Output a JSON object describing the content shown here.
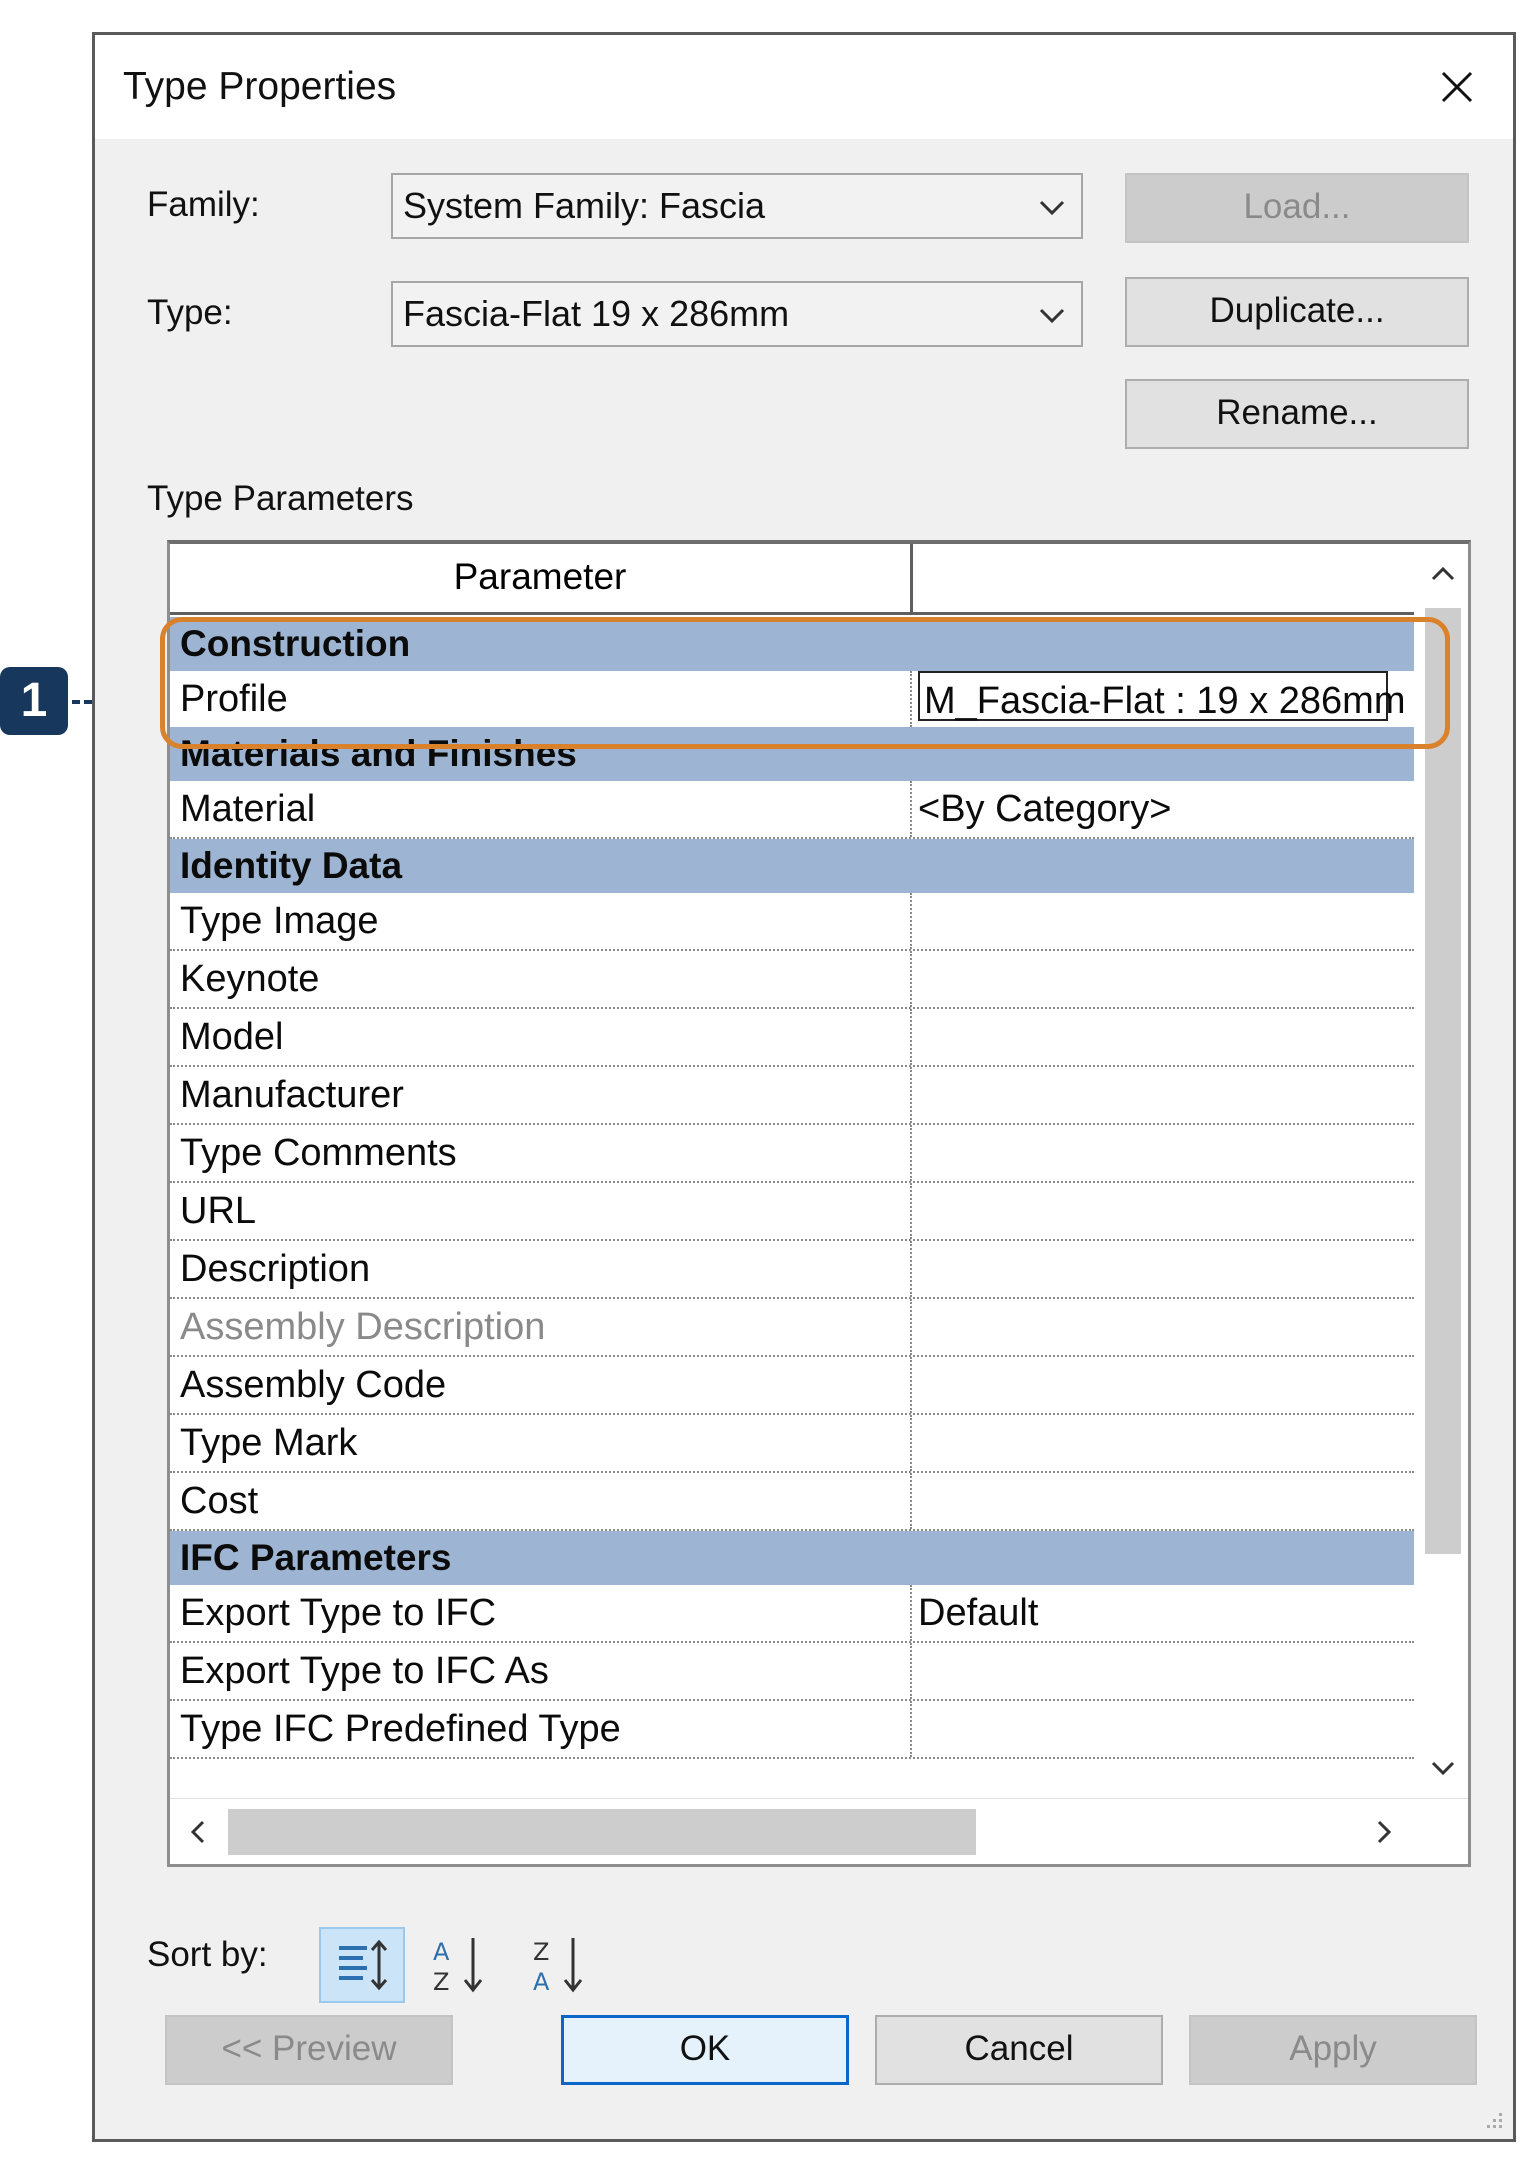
{
  "dialog": {
    "title": "Type Properties",
    "family_label": "Family:",
    "family_value": "System Family: Fascia",
    "type_label": "Type:",
    "type_value": "Fascia-Flat 19 x 286mm",
    "load_label": "Load...",
    "duplicate_label": "Duplicate...",
    "rename_label": "Rename...",
    "type_parameters_label": "Type Parameters"
  },
  "grid": {
    "header_parameter": "Parameter",
    "header_value": "",
    "rows": [
      {
        "kind": "section",
        "label": "Construction"
      },
      {
        "kind": "param",
        "label": "Profile",
        "value": "M_Fascia-Flat : 19 x 286mm",
        "editing": true
      },
      {
        "kind": "section",
        "label": "Materials and Finishes"
      },
      {
        "kind": "param",
        "label": "Material",
        "value": "<By Category>"
      },
      {
        "kind": "section",
        "label": "Identity Data"
      },
      {
        "kind": "param",
        "label": "Type Image",
        "value": ""
      },
      {
        "kind": "param",
        "label": "Keynote",
        "value": ""
      },
      {
        "kind": "param",
        "label": "Model",
        "value": ""
      },
      {
        "kind": "param",
        "label": "Manufacturer",
        "value": ""
      },
      {
        "kind": "param",
        "label": "Type Comments",
        "value": ""
      },
      {
        "kind": "param",
        "label": "URL",
        "value": ""
      },
      {
        "kind": "param",
        "label": "Description",
        "value": ""
      },
      {
        "kind": "param",
        "label": "Assembly Description",
        "value": "",
        "dim": true
      },
      {
        "kind": "param",
        "label": "Assembly Code",
        "value": ""
      },
      {
        "kind": "param",
        "label": "Type Mark",
        "value": ""
      },
      {
        "kind": "param",
        "label": "Cost",
        "value": ""
      },
      {
        "kind": "section",
        "label": "IFC Parameters"
      },
      {
        "kind": "param",
        "label": "Export Type to IFC",
        "value": "Default"
      },
      {
        "kind": "param",
        "label": "Export Type to IFC As",
        "value": ""
      },
      {
        "kind": "param",
        "label": "Type IFC Predefined Type",
        "value": ""
      }
    ]
  },
  "sort": {
    "label": "Sort by:"
  },
  "footer": {
    "preview_label": "<< Preview",
    "ok_label": "OK",
    "cancel_label": "Cancel",
    "apply_label": "Apply"
  },
  "callout": {
    "number": "1"
  },
  "colors": {
    "section_bg": "#9db5d2",
    "highlight": "#d9822b",
    "callout": "#17385c",
    "default_button_border": "#0a66c8"
  }
}
